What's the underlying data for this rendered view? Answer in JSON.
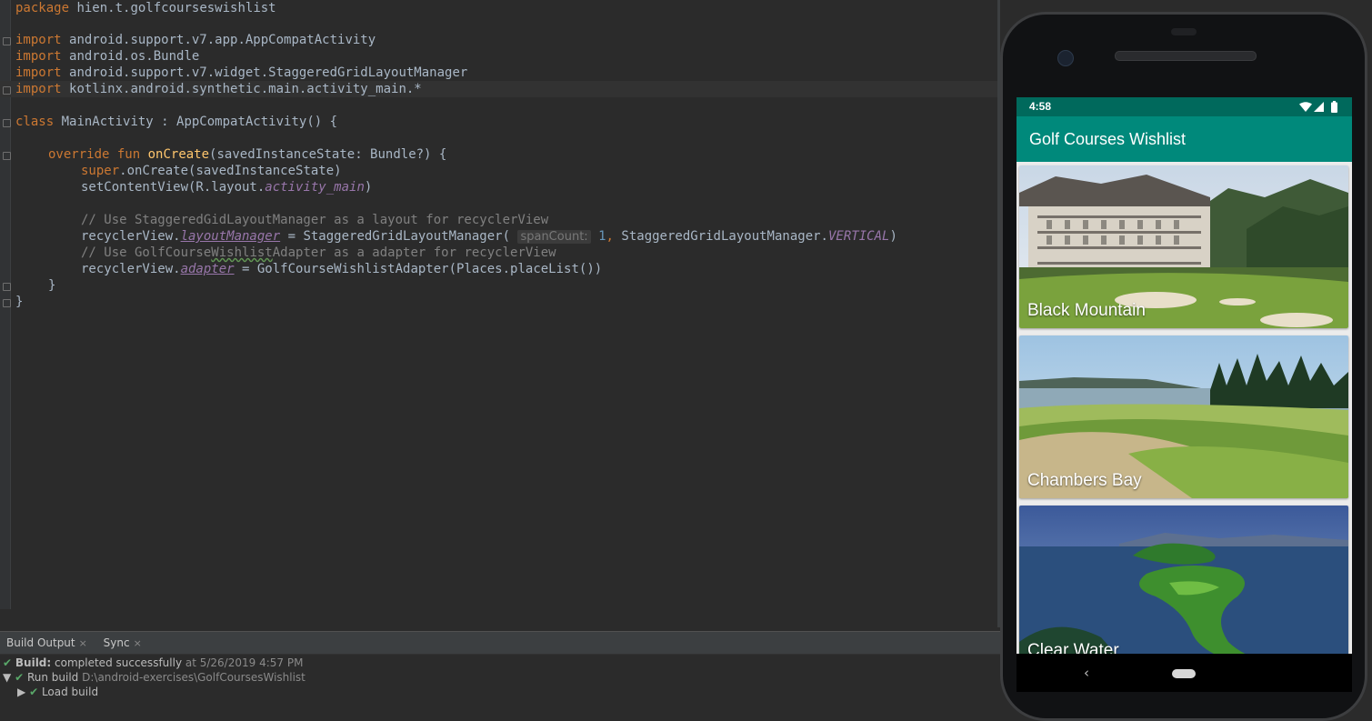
{
  "editor": {
    "package_kw": "package",
    "package_name": "hien.t.golfcourseswishlist",
    "import_kw": "import",
    "imports": [
      "android.support.v7.app.AppCompatActivity",
      "android.os.Bundle",
      "android.support.v7.widget.StaggeredGridLayoutManager",
      "kotlinx.android.synthetic.main.activity_main.*"
    ],
    "class_kw": "class",
    "class_decl": "MainActivity : AppCompatActivity() {",
    "override_kw": "override",
    "fun_kw": "fun",
    "fun_name": "onCreate",
    "fun_params": "(savedInstanceState: Bundle?) {",
    "super_kw": "super",
    "super_call": ".onCreate(savedInstanceState)",
    "set_content_a": "setContentView(R.layout.",
    "set_content_it": "activity_main",
    "set_content_b": ")",
    "comment1": "// Use StaggeredGidLayoutManager as a layout for recyclerView",
    "lm_a": "recyclerView.",
    "lm_prop": "layoutManager",
    "lm_b": " = StaggeredGridLayoutManager( ",
    "lm_hint": "spanCount:",
    "lm_num": "1",
    "lm_comma": ",",
    "lm_c": " StaggeredGridLayoutManager.",
    "lm_const": "VERTICAL",
    "lm_d": ")",
    "comment2_a": "// Use GolfCourse",
    "comment2_typo": "Wishlist",
    "comment2_b": "Adapter as a adapter for recyclerView",
    "ad_a": "recyclerView.",
    "ad_prop": "adapter",
    "ad_b": " = GolfCourseWishlistAdapter(Places.placeList())",
    "close_inner": "}",
    "close_outer": "}"
  },
  "build": {
    "tabs": [
      "Build Output",
      "Sync"
    ],
    "close_glyph": "×",
    "check_glyph": "✔",
    "line1_bold": "Build:",
    "line1_text": " completed successfully",
    "line1_time": " at 5/26/2019 4:57 PM",
    "line2_arrow": "▼",
    "line2_text": "Run build",
    "line2_path": " D:\\android-exercises\\GolfCoursesWishlist",
    "line3_arrow": "▶",
    "line3_text": "Load build"
  },
  "phone": {
    "status_time": "4:58",
    "app_title": "Golf Courses Wishlist",
    "places": [
      {
        "name": "Black Mountain"
      },
      {
        "name": "Chambers Bay"
      },
      {
        "name": "Clear Water"
      }
    ],
    "back_glyph": "‹",
    "colors": {
      "status_bar": "#00695c",
      "app_bar": "#00897b"
    }
  }
}
